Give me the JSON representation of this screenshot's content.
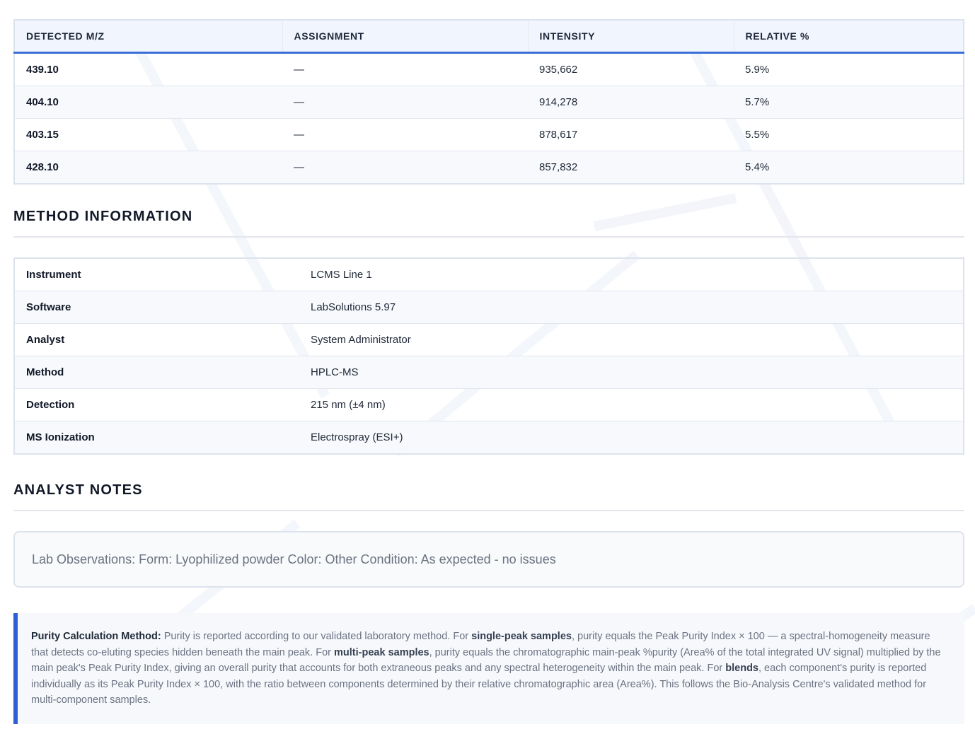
{
  "peaks_table": {
    "headers": [
      "DETECTED M/Z",
      "ASSIGNMENT",
      "INTENSITY",
      "RELATIVE %"
    ],
    "rows": [
      {
        "mz": "439.10",
        "assignment": "—",
        "intensity": "935,662",
        "relative": "5.9%"
      },
      {
        "mz": "404.10",
        "assignment": "—",
        "intensity": "914,278",
        "relative": "5.7%"
      },
      {
        "mz": "403.15",
        "assignment": "—",
        "intensity": "878,617",
        "relative": "5.5%"
      },
      {
        "mz": "428.10",
        "assignment": "—",
        "intensity": "857,832",
        "relative": "5.4%"
      }
    ]
  },
  "method_info": {
    "title": "METHOD INFORMATION",
    "rows": [
      {
        "key": "Instrument",
        "value": "LCMS Line 1"
      },
      {
        "key": "Software",
        "value": "LabSolutions 5.97"
      },
      {
        "key": "Analyst",
        "value": "System Administrator"
      },
      {
        "key": "Method",
        "value": "HPLC-MS"
      },
      {
        "key": "Detection",
        "value": "215 nm (±4 nm)"
      },
      {
        "key": "MS Ionization",
        "value": "Electrospray (ESI+)"
      }
    ]
  },
  "analyst_notes": {
    "title": "ANALYST NOTES",
    "text": "Lab Observations: Form: Lyophilized powder Color: Other Condition: As expected - no issues"
  },
  "purity": {
    "lead": "Purity Calculation Method:",
    "t1": " Purity is reported according to our validated laboratory method. For ",
    "b1": "single-peak samples",
    "t2": ", purity equals the Peak Purity Index × 100 — a spectral-homogeneity measure that detects co-eluting species hidden beneath the main peak. For ",
    "b2": "multi-peak samples",
    "t3": ", purity equals the chromatographic main-peak %purity (Area% of the total integrated UV signal) multiplied by the main peak's Peak Purity Index, giving an overall purity that accounts for both extraneous peaks and any spectral heterogeneity within the main peak. For ",
    "b3": "blends",
    "t4": ", each component's purity is reported individually as its Peak Purity Index × 100, with the ratio between components determined by their relative chromatographic area (Area%). This follows the Bio-Analysis Centre's validated method for multi-component samples."
  },
  "colors": {
    "accent": "#2e5fd6",
    "header_bg": "#f1f5fd",
    "border": "#dde3ec"
  }
}
